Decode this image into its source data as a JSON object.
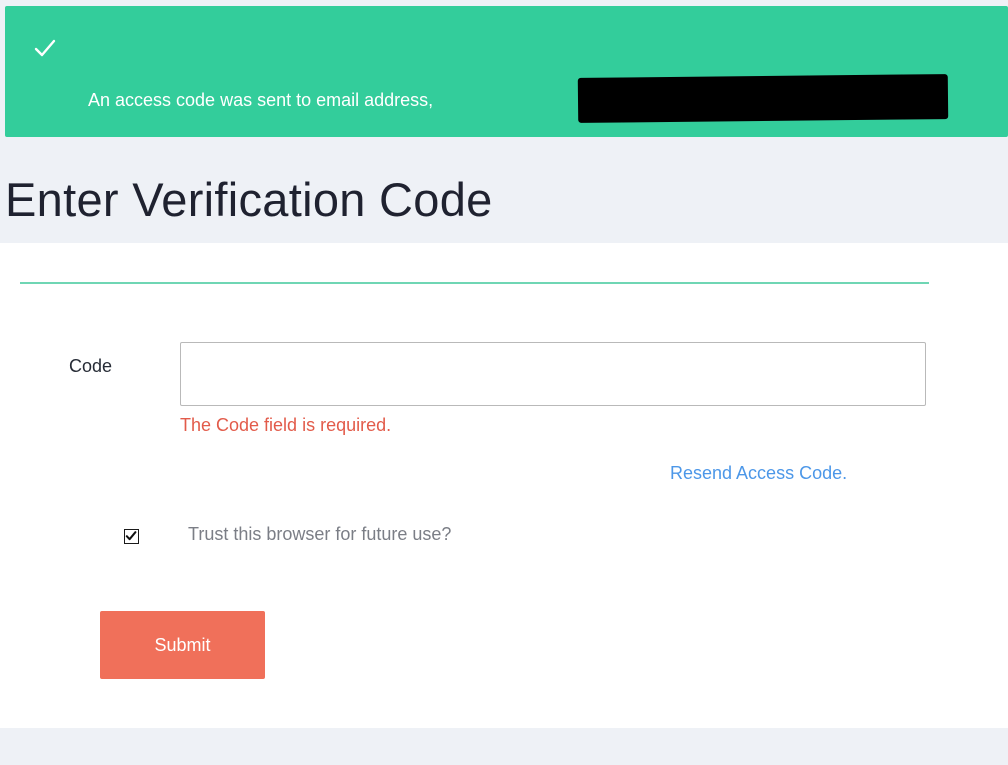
{
  "alert": {
    "icon": "checkmark-icon",
    "message": "An access code was sent to email address,",
    "background": "#33cd9b"
  },
  "page": {
    "title": "Enter Verification Code"
  },
  "form": {
    "code_label": "Code",
    "code_value": "",
    "code_placeholder": "",
    "error_message": "The Code field is required.",
    "resend_link": "Resend Access Code.",
    "trust_label": "Trust this browser for future use?",
    "trust_checked": true,
    "submit_label": "Submit",
    "submit_color": "#f0705a"
  }
}
